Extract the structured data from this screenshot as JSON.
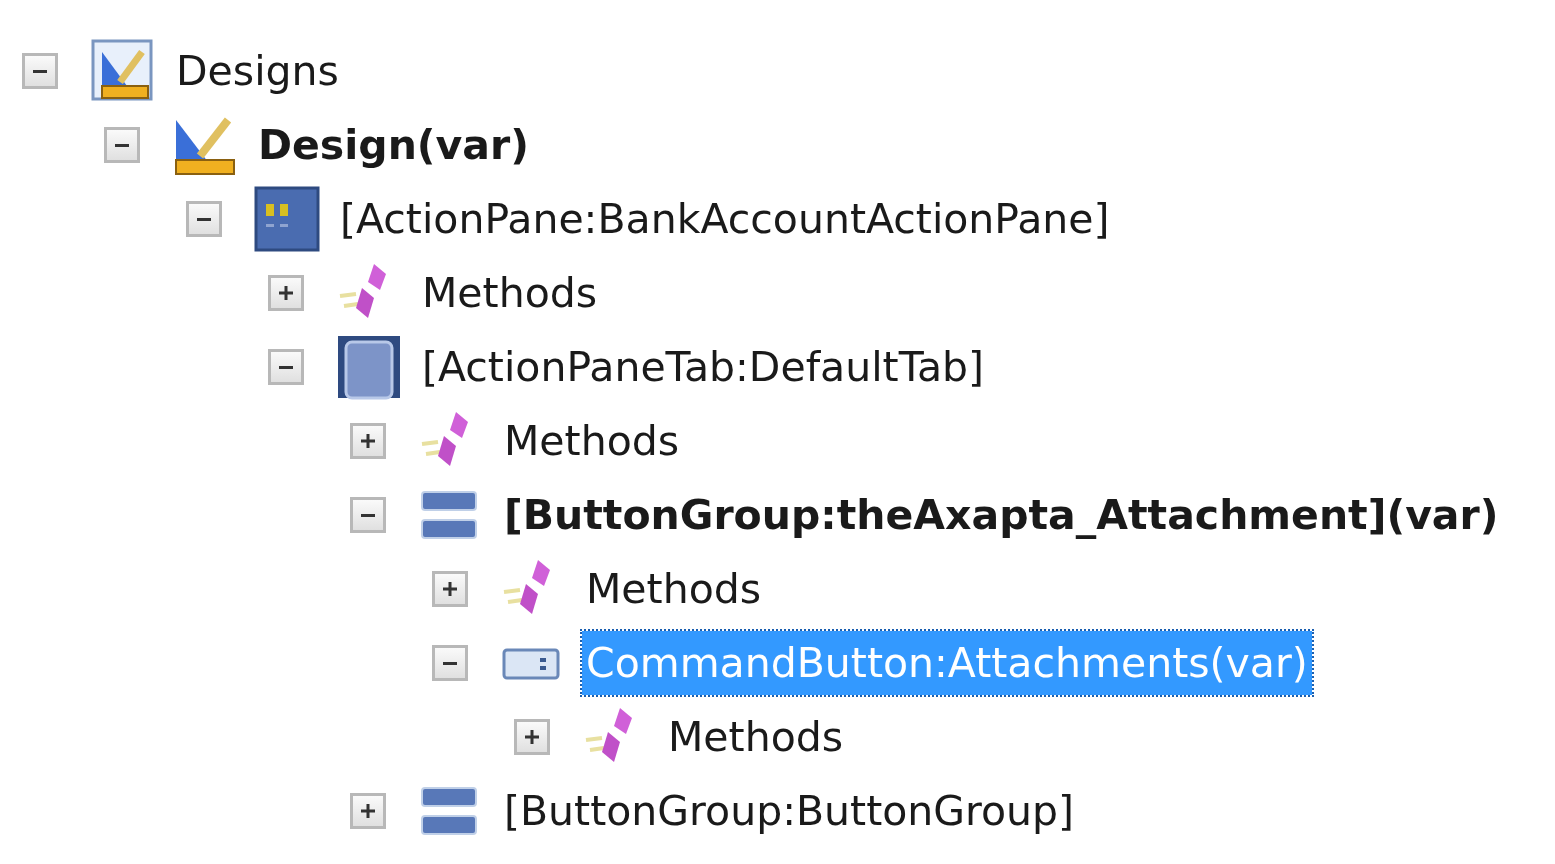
{
  "tree": [
    {
      "label": "Designs",
      "kind": "designs",
      "expanded": true,
      "bold": false,
      "selected": false,
      "children": [
        {
          "label": "Design(var)",
          "kind": "design",
          "expanded": true,
          "bold": true,
          "selected": false,
          "children": [
            {
              "label": "[ActionPane:BankAccountActionPane]",
              "kind": "actionpane",
              "expanded": true,
              "bold": false,
              "selected": false,
              "children": [
                {
                  "label": "Methods",
                  "kind": "methods",
                  "expanded": false,
                  "bold": false,
                  "selected": false
                },
                {
                  "label": "[ActionPaneTab:DefaultTab]",
                  "kind": "tab",
                  "expanded": true,
                  "bold": false,
                  "selected": false,
                  "children": [
                    {
                      "label": "Methods",
                      "kind": "methods",
                      "expanded": false,
                      "bold": false,
                      "selected": false
                    },
                    {
                      "label": "[ButtonGroup:theAxapta_Attachment](var)",
                      "kind": "buttongroup",
                      "expanded": true,
                      "bold": true,
                      "selected": false,
                      "children": [
                        {
                          "label": "Methods",
                          "kind": "methods",
                          "expanded": false,
                          "bold": false,
                          "selected": false
                        },
                        {
                          "label": "CommandButton:Attachments(var)",
                          "kind": "commandbutton",
                          "expanded": true,
                          "bold": false,
                          "selected": true,
                          "children": [
                            {
                              "label": "Methods",
                              "kind": "methods",
                              "expanded": false,
                              "bold": false,
                              "selected": false
                            }
                          ]
                        }
                      ]
                    },
                    {
                      "label": "[ButtonGroup:ButtonGroup]",
                      "kind": "buttongroup",
                      "expanded": false,
                      "bold": false,
                      "selected": false
                    }
                  ]
                }
              ]
            }
          ]
        }
      ]
    }
  ]
}
